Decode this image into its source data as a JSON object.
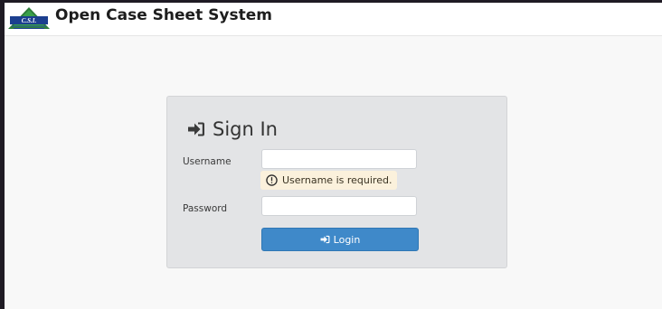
{
  "app": {
    "title": "Open Case Sheet System",
    "logo_text": "C.S.I."
  },
  "login_form": {
    "heading": "Sign In",
    "username_label": "Username",
    "username_value": "",
    "username_error": "Username is required.",
    "password_label": "Password",
    "password_value": "",
    "submit_label": "Login"
  },
  "icons": {
    "heading_icon": "sign-in-icon",
    "error_icon": "exclamation-circle-icon",
    "button_icon": "sign-in-icon"
  },
  "colors": {
    "primary_button": "#3f89c9",
    "error_background": "#fbf1dc",
    "panel_background": "#e3e4e6"
  }
}
